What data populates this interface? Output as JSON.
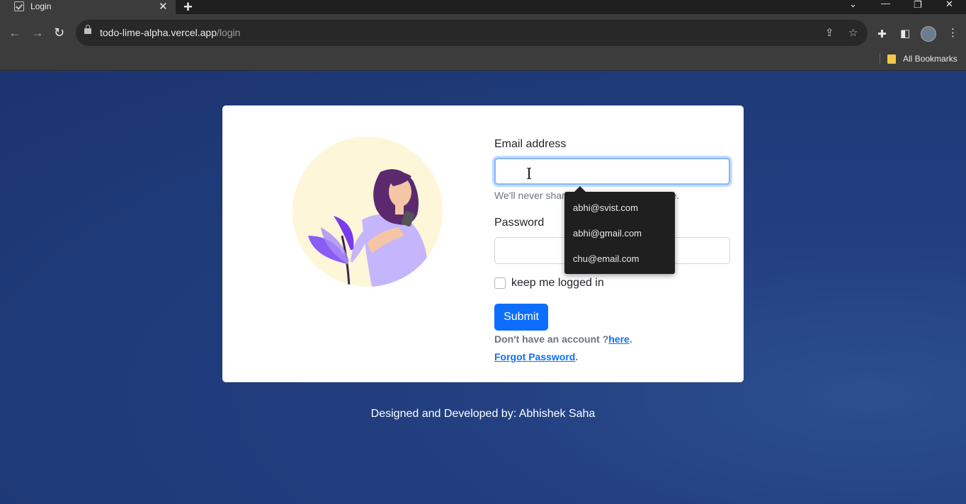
{
  "browser": {
    "tab_title": "Login",
    "url_host": "todo-lime-alpha.vercel.app",
    "url_path": "/login",
    "bookmarks_label": "All Bookmarks"
  },
  "form": {
    "email_label": "Email address",
    "email_value": "",
    "email_help_prefix": "We'll never shar",
    "email_help_suffix": "else.",
    "password_label": "Password",
    "password_value": "",
    "remember_label": "keep me logged in",
    "remember_checked": false,
    "submit_label": "Submit",
    "signup_prompt": "Don't have an account ?",
    "signup_link": "here",
    "signup_period": ".",
    "forgot_link": "Forgot Password",
    "forgot_period": "."
  },
  "autocomplete": {
    "options": [
      "abhi@svist.com",
      "abhi@gmail.com",
      "chu@email.com"
    ]
  },
  "footer": {
    "credit": "Designed and Developed by: Abhishek Saha"
  },
  "colors": {
    "page_bg": "#1f3c7a",
    "primary": "#0d6efd",
    "illus_circle": "#fdf6d8",
    "illus_purple": "#a78bfa",
    "illus_hair": "#5b2a6e"
  },
  "icons": {
    "tab_favicon": "checkbox-favicon-icon",
    "back": "arrow-left-icon",
    "forward": "arrow-right-icon",
    "reload": "reload-icon",
    "lock": "lock-icon",
    "share": "share-icon",
    "bookmark": "star-icon",
    "extensions": "puzzle-icon",
    "side_panel": "side-panel-icon",
    "menu": "kebab-menu-icon",
    "folder": "folder-icon"
  }
}
